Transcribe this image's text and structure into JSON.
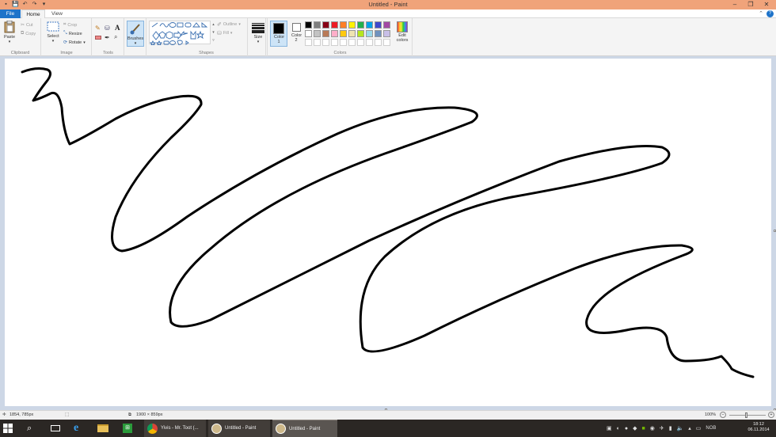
{
  "window": {
    "title": "Untitled - Paint",
    "quick_access": [
      "save-icon",
      "undo-icon",
      "redo-icon",
      "dropdown-icon"
    ]
  },
  "menu": {
    "file": "File",
    "home": "Home",
    "view": "View"
  },
  "ribbon": {
    "clipboard": {
      "paste": "Paste",
      "cut": "Cut",
      "copy": "Copy",
      "label": "Clipboard"
    },
    "image": {
      "select": "Select",
      "crop": "Crop",
      "resize": "Resize",
      "rotate": "Rotate",
      "label": "Image"
    },
    "tools": {
      "label": "Tools",
      "text_glyph": "A"
    },
    "brushes": {
      "label": "Brushes"
    },
    "shapes": {
      "outline": "Outline",
      "fill": "Fill",
      "label": "Shapes"
    },
    "size": {
      "label": "Size"
    },
    "colors": {
      "color1": "Color 1",
      "color2": "Color 2",
      "edit": "Edit colors",
      "label": "Colors",
      "color1_value": "#000000",
      "color2_value": "#ffffff",
      "palette_row1": [
        "#000000",
        "#7f7f7f",
        "#880015",
        "#ed1c24",
        "#ff7f27",
        "#fff200",
        "#22b14c",
        "#00a2e8",
        "#3f48cc",
        "#a349a4"
      ],
      "palette_row2": [
        "#ffffff",
        "#c3c3c3",
        "#b97a57",
        "#ffaec9",
        "#ffc90e",
        "#efe4b0",
        "#b5e61d",
        "#99d9ea",
        "#7092be",
        "#c8bfe7"
      ],
      "palette_row3": [
        "#ffffff",
        "#ffffff",
        "#ffffff",
        "#ffffff",
        "#ffffff",
        "#ffffff",
        "#ffffff",
        "#ffffff",
        "#ffffff",
        "#ffffff"
      ]
    }
  },
  "status": {
    "cursor_pos": "1854, 785px",
    "image_size": "1900 × 859px",
    "zoom": "100%"
  },
  "taskbar": {
    "apps": [
      {
        "name": "Yivis - Mr. Toot (...",
        "icon": "chrome-icon"
      },
      {
        "name": "Untitled - Paint",
        "icon": "paint-icon"
      },
      {
        "name": "Untitled - Paint",
        "icon": "paint-icon"
      }
    ],
    "lang": "NOB",
    "time": "18:12",
    "date": "06.11.2014"
  }
}
